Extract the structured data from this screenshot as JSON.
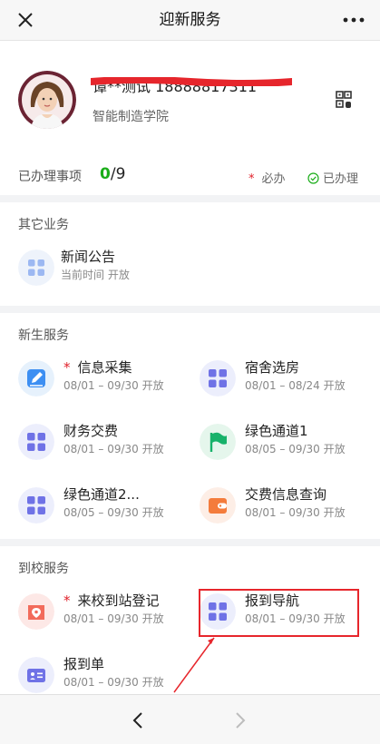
{
  "header": {
    "title": "迎新服务"
  },
  "profile": {
    "name": "谭**测试 18888817311",
    "school": "智能制造学院"
  },
  "progress": {
    "label": "已办理事项",
    "done": "0",
    "total": "/9",
    "legend_required_mark": "*",
    "legend_required": "必办",
    "legend_done": "已办理"
  },
  "other": {
    "title": "其它业务",
    "items": [
      {
        "label": "新闻公告",
        "sub": "当前时间 开放"
      }
    ]
  },
  "newstudent": {
    "title": "新生服务",
    "items": [
      {
        "label": "信息采集",
        "sub": "08/01 – 09/30 开放",
        "required": "*"
      },
      {
        "label": "宿舍选房",
        "sub": "08/01 – 08/24 开放"
      },
      {
        "label": "财务交费",
        "sub": "08/01 – 09/30 开放"
      },
      {
        "label": "绿色通道1",
        "sub": "08/05 – 09/30 开放"
      },
      {
        "label": "绿色通道2...",
        "sub": "08/05 – 09/30 开放"
      },
      {
        "label": "交费信息查询",
        "sub": "08/01 – 09/30 开放"
      }
    ]
  },
  "arrival": {
    "title": "到校服务",
    "items": [
      {
        "label": "来校到站登记",
        "sub": "08/01 – 09/30 开放",
        "required": "*"
      },
      {
        "label": "报到导航",
        "sub": "08/01 – 09/30 开放"
      },
      {
        "label": "报到单",
        "sub": "08/01 – 09/30 开放"
      }
    ]
  },
  "colors": {
    "accent": "#1aad19",
    "required": "#e0202a",
    "icon_purple": "#6f72e6",
    "highlight": "#e7262c"
  },
  "icons": {
    "close": "close-icon",
    "more": "more-icon",
    "qr": "qr-icon",
    "back": "chevron-left-icon",
    "forward": "chevron-right-icon"
  }
}
